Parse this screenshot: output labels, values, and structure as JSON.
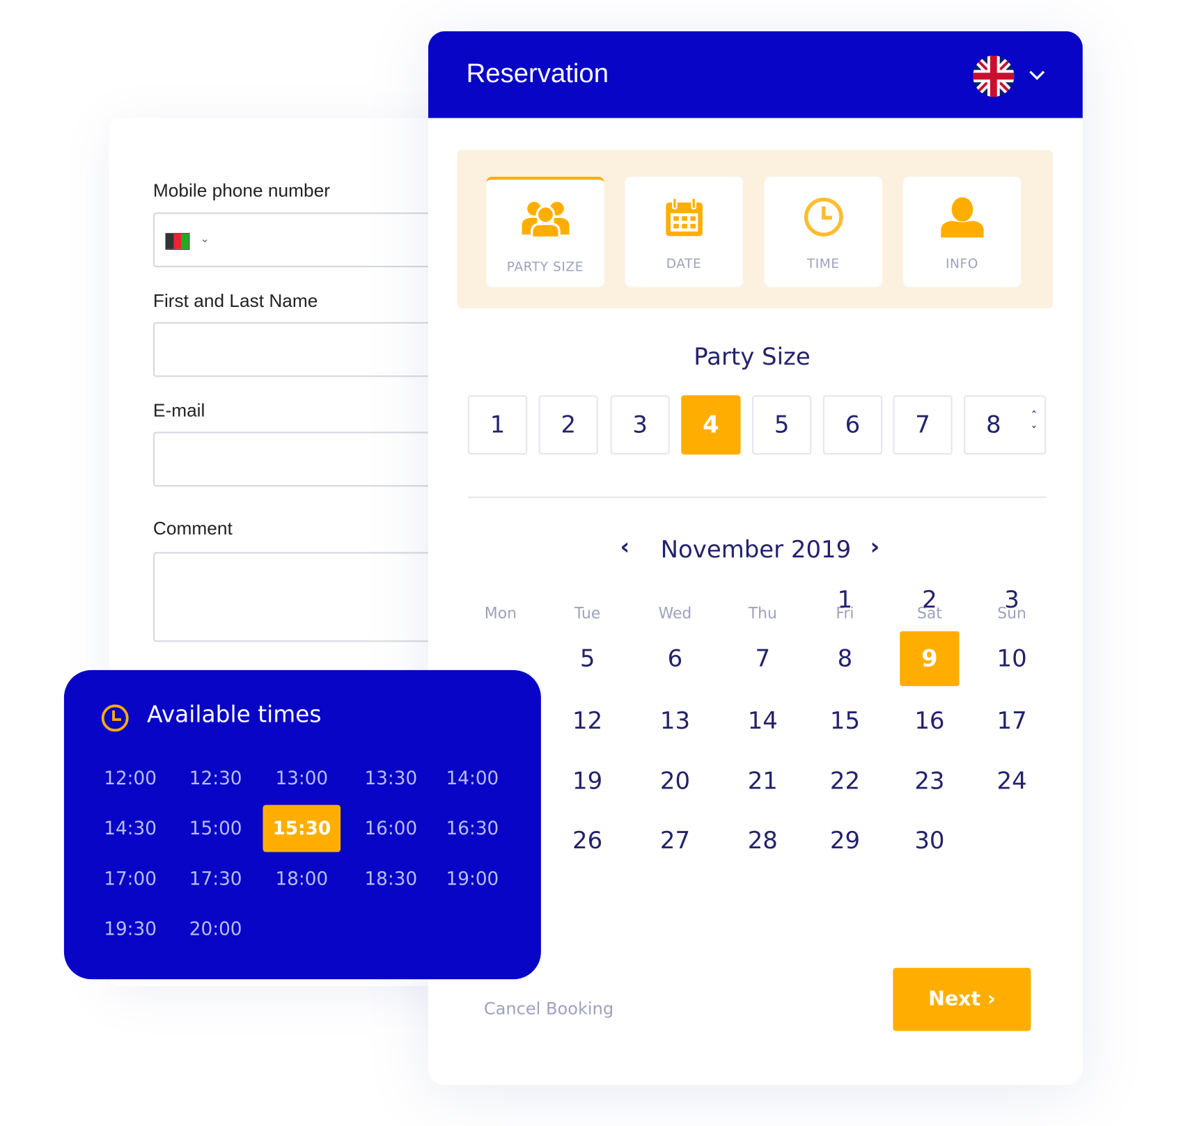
{
  "form": {
    "phone_label": "Mobile phone number",
    "phone_country": "Afghanistan",
    "name_label": "First and Last Name",
    "email_label": "E-mail",
    "comment_label": "Comment"
  },
  "header": {
    "title": "Reservation",
    "language_flag": "uk-flag-icon"
  },
  "steps": [
    {
      "label": "PARTY SIZE",
      "icon": "group-icon",
      "active": true
    },
    {
      "label": "DATE",
      "icon": "calendar-icon",
      "active": false
    },
    {
      "label": "TIME",
      "icon": "clock-icon",
      "active": false
    },
    {
      "label": "INFO",
      "icon": "user-icon",
      "active": false
    }
  ],
  "party_size": {
    "title": "Party Size",
    "options": [
      "1",
      "2",
      "3",
      "4",
      "5",
      "6",
      "7",
      "8"
    ],
    "selected": "4"
  },
  "calendar": {
    "month_label": "November 2019",
    "weekdays": [
      "Mon",
      "Tue",
      "Wed",
      "Thu",
      "Fri",
      "Sat",
      "Sun"
    ],
    "rows": [
      [
        "",
        "",
        "",
        "",
        "1",
        "2",
        "3"
      ],
      [
        "",
        "5",
        "6",
        "7",
        "8",
        "9",
        "10"
      ],
      [
        "",
        "12",
        "13",
        "14",
        "15",
        "16",
        "17"
      ],
      [
        "",
        "19",
        "20",
        "21",
        "22",
        "23",
        "24"
      ],
      [
        "",
        "26",
        "27",
        "28",
        "29",
        "30",
        ""
      ]
    ],
    "selected": "9"
  },
  "footer": {
    "cancel_label": "Cancel Booking",
    "next_label": "Next"
  },
  "available_times": {
    "title": "Available times",
    "times": [
      "12:00",
      "12:30",
      "13:00",
      "13:30",
      "14:00",
      "14:30",
      "15:00",
      "15:30",
      "16:00",
      "16:30",
      "17:00",
      "17:30",
      "18:00",
      "18:30",
      "19:00",
      "19:30",
      "20:00"
    ],
    "selected": "15:30"
  },
  "colors": {
    "brand_blue": "#0805C6",
    "accent": "#FFAE00",
    "text_navy": "#23226B",
    "muted": "#9EA1BD"
  }
}
